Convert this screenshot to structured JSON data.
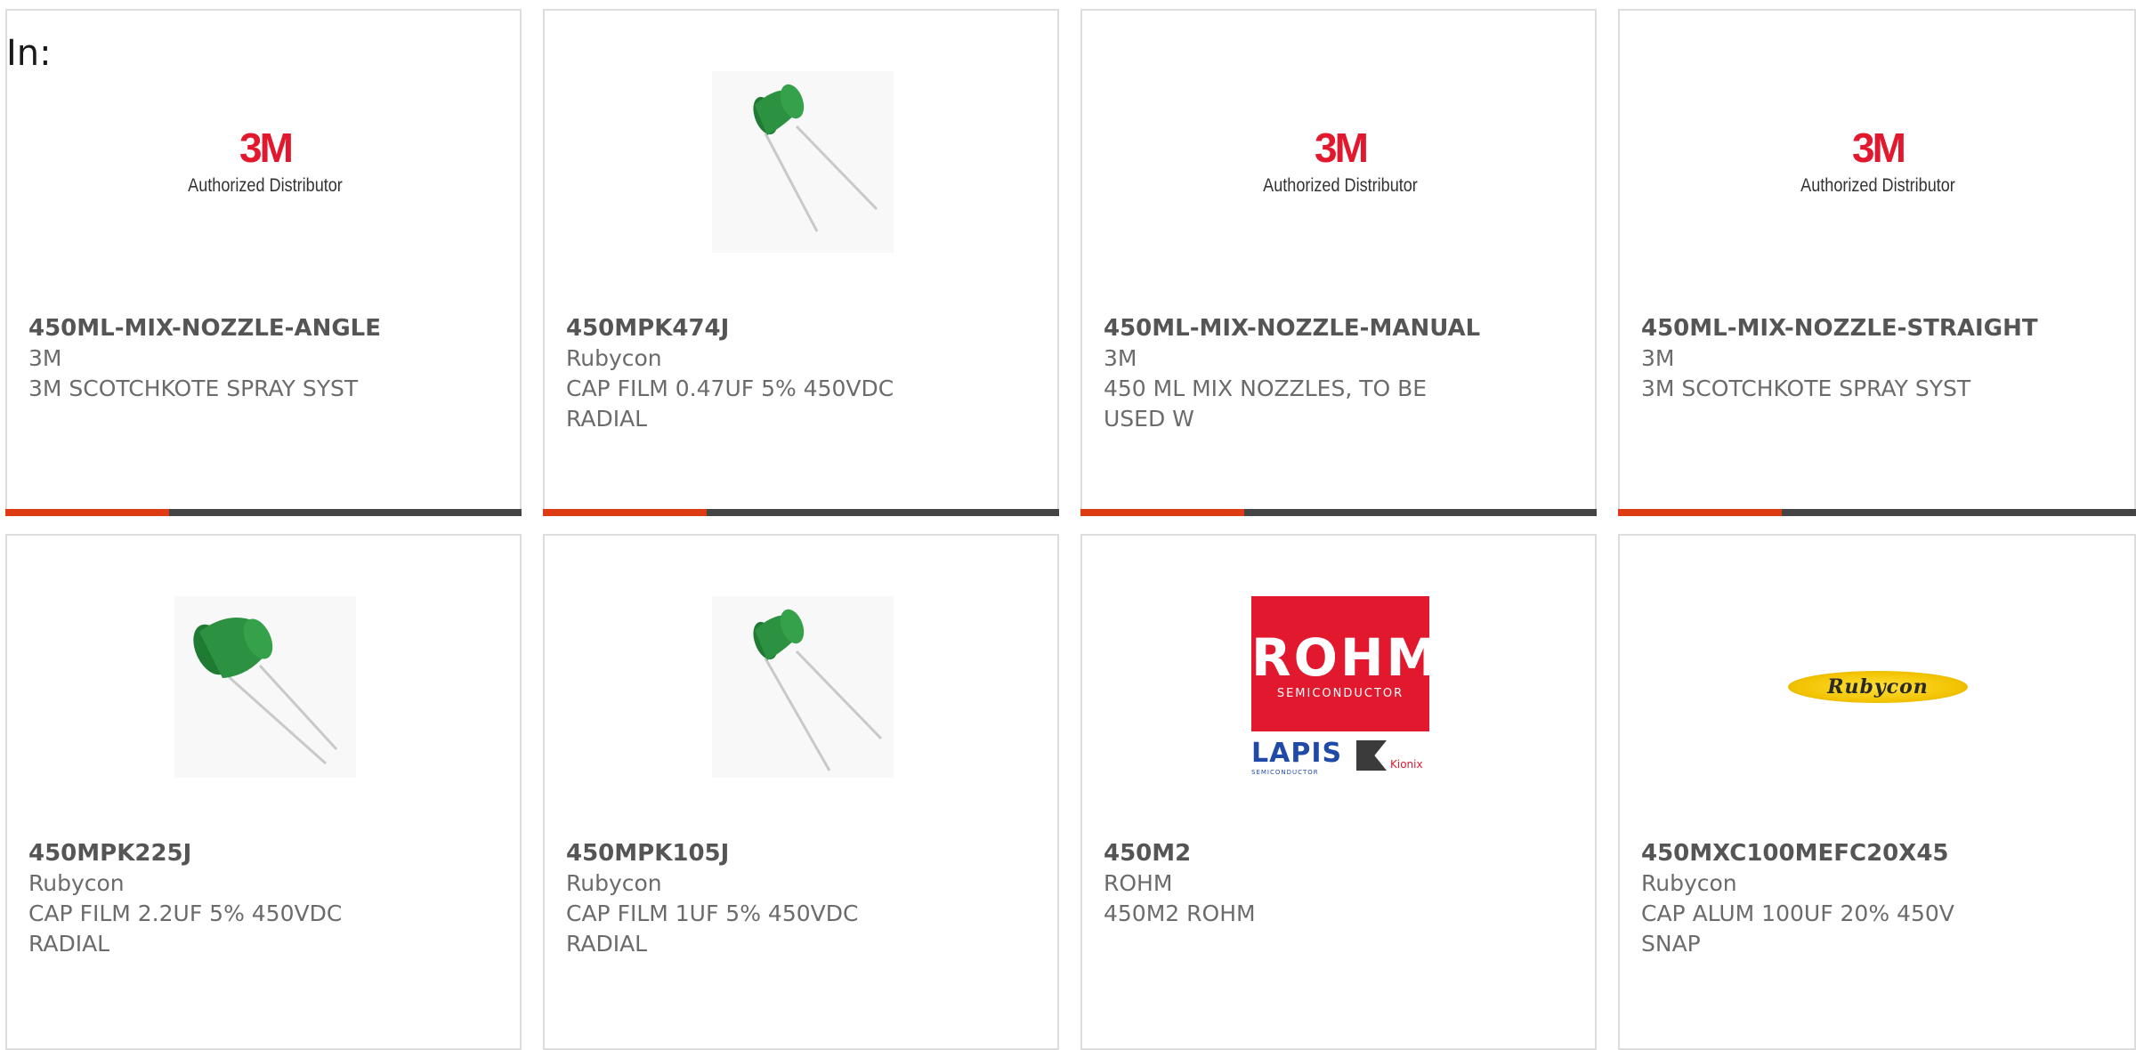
{
  "header": {
    "label": "In:"
  },
  "colors": {
    "accent": "#dd3b13",
    "bar": "#444444",
    "brand_3m_red": "#e2192e",
    "rohm_red": "#e2192e",
    "rubycon_yellow": "#f2c200"
  },
  "products": [
    {
      "part_number": "450ML-MIX-NOZZLE-ANGLE",
      "manufacturer": "3M",
      "description": "3M SCOTCHKOTE SPRAY SYST",
      "image": "3m-authorized-distributor-logo"
    },
    {
      "part_number": "450MPK474J",
      "manufacturer": "Rubycon",
      "description": "CAP FILM 0.47UF 5% 450VDC RADIAL",
      "image": "film-capacitor-photo"
    },
    {
      "part_number": "450ML-MIX-NOZZLE-MANUAL",
      "manufacturer": "3M",
      "description": "450 ML MIX NOZZLES, TO BE USED W",
      "image": "3m-authorized-distributor-logo"
    },
    {
      "part_number": "450ML-MIX-NOZZLE-STRAIGHT",
      "manufacturer": "3M",
      "description": "3M SCOTCHKOTE SPRAY SYST",
      "image": "3m-authorized-distributor-logo"
    },
    {
      "part_number": "450MPK225J",
      "manufacturer": "Rubycon",
      "description": "CAP FILM 2.2UF 5% 450VDC RADIAL",
      "image": "film-capacitor-photo"
    },
    {
      "part_number": "450MPK105J",
      "manufacturer": "Rubycon",
      "description": "CAP FILM 1UF 5% 450VDC RADIAL",
      "image": "film-capacitor-photo"
    },
    {
      "part_number": "450M2",
      "manufacturer": "ROHM",
      "description": "450M2 ROHM",
      "image": "rohm-lapis-kionix-logo"
    },
    {
      "part_number": "450MXC100MEFC20X45",
      "manufacturer": "Rubycon",
      "description": "CAP ALUM 100UF 20% 450V SNAP",
      "image": "rubycon-logo"
    }
  ],
  "logos": {
    "three_m": {
      "mark": "3M",
      "sub": "Authorized Distributor"
    },
    "rohm": {
      "big": "ROHM",
      "small": "SEMICONDUCTOR",
      "lapis": "LAPIS",
      "lapis_sub": "SEMICONDUCTOR",
      "kionix": "Kionix"
    },
    "rubycon": {
      "text": "Rubycon"
    }
  }
}
